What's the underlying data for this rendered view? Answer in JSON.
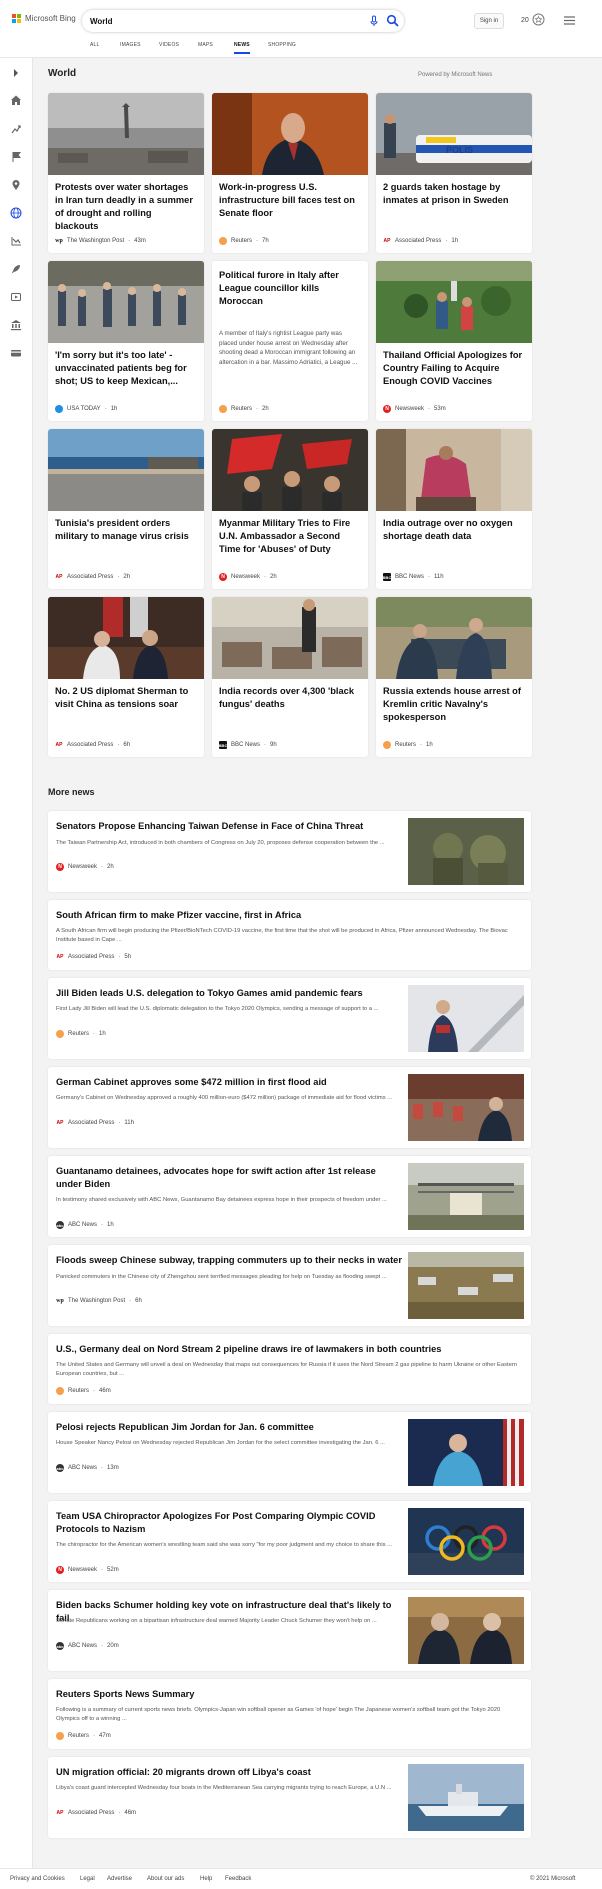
{
  "brand": {
    "name": "Microsoft Bing"
  },
  "search": {
    "query": "World",
    "placeholder": ""
  },
  "header": {
    "sign_in": "Sign in",
    "rewards_points": "20"
  },
  "tabs": [
    {
      "label": "ALL"
    },
    {
      "label": "IMAGES"
    },
    {
      "label": "VIDEOS"
    },
    {
      "label": "MAPS"
    },
    {
      "label": "NEWS",
      "active": true
    },
    {
      "label": "SHOPPING"
    }
  ],
  "section": {
    "title": "World",
    "powered_by": "Powered by Microsoft News"
  },
  "cards": [
    {
      "title": "Protests over water shortages in Iran turn deadly in a summer of drought and rolling blackouts",
      "source": "The Washington Post",
      "age": "43m",
      "logo": "wp"
    },
    {
      "title": "Work-in-progress U.S. infrastructure bill faces test on Senate floor",
      "source": "Reuters",
      "age": "7h",
      "logo": "reuters"
    },
    {
      "title": "2 guards taken hostage by inmates at prison in Sweden",
      "source": "Associated Press",
      "age": "1h",
      "logo": "ap"
    },
    {
      "title": "'I'm sorry but it's too late' - unvaccinated patients beg for shot; US to keep Mexican,...",
      "source": "USA TODAY",
      "age": "1h",
      "logo": "usatoday"
    },
    {
      "title": "Political furore in Italy after League councillor kills Moroccan",
      "description": "A member of Italy's rightist League party was placed under house arrest on Wednesday after shooting dead a Moroccan immigrant following an altercation in a bar. Massimo Adriatici, a League ...",
      "source": "Reuters",
      "age": "2h",
      "logo": "reuters"
    },
    {
      "title": "Thailand Official Apologizes for Country Failing to Acquire Enough COVID Vaccines",
      "source": "Newsweek",
      "age": "53m",
      "logo": "newsweek"
    },
    {
      "title": "Tunisia's president orders military to manage virus crisis",
      "source": "Associated Press",
      "age": "2h",
      "logo": "ap"
    },
    {
      "title": "Myanmar Military Tries to Fire U.N. Ambassador a Second Time for 'Abuses' of Duty",
      "source": "Newsweek",
      "age": "2h",
      "logo": "newsweek"
    },
    {
      "title": "India outrage over no oxygen shortage death data",
      "source": "BBC News",
      "age": "11h",
      "logo": "bbc"
    },
    {
      "title": "No. 2 US diplomat Sherman to visit China as tensions soar",
      "source": "Associated Press",
      "age": "6h",
      "logo": "ap"
    },
    {
      "title": "India records over 4,300 'black fungus' deaths",
      "source": "BBC News",
      "age": "9h",
      "logo": "bbc"
    },
    {
      "title": "Russia extends house arrest of Kremlin critic Navalny's spokesperson",
      "source": "Reuters",
      "age": "1h",
      "logo": "reuters"
    }
  ],
  "more_news": {
    "title": "More news",
    "items": [
      {
        "title": "Senators Propose Enhancing Taiwan Defense in Face of China Threat",
        "description": "The Taiwan Partnership Act, introduced in both chambers of Congress on July 20, proposes defense cooperation between the ...",
        "source": "Newsweek",
        "age": "2h",
        "logo": "newsweek"
      },
      {
        "title": "South African firm to make Pfizer vaccine, first in Africa",
        "description": "A South African firm will begin producing the Pfizer/BioNTech COVID-19 vaccine, the first time that the shot will be produced in Africa, Pfizer announced Wednesday. The Biovac Institute based in Cape ...",
        "source": "Associated Press",
        "age": "5h",
        "logo": "ap"
      },
      {
        "title": "Jill Biden leads U.S. delegation to Tokyo Games amid pandemic fears",
        "description": "First Lady Jill Biden will lead the U.S. diplomatic delegation to the Tokyo 2020 Olympics, sending a message of support to a ...",
        "source": "Reuters",
        "age": "1h",
        "logo": "reuters"
      },
      {
        "title": "German Cabinet approves some $472 million in first flood aid",
        "description": "Germany's Cabinet on Wednesday approved a roughly 400 million-euro ($472 million) package of immediate aid for flood victims ...",
        "source": "Associated Press",
        "age": "11h",
        "logo": "ap"
      },
      {
        "title": "Guantanamo detainees, advocates hope for swift action after 1st release under Biden",
        "description": "In testimony shared exclusively with ABC News, Guantanamo Bay detainees express hope in their prospects of freedom under ...",
        "source": "ABC News",
        "age": "1h",
        "logo": "abc"
      },
      {
        "title": "Floods sweep Chinese subway, trapping commuters up to their necks in water",
        "description": "Panicked commuters in the Chinese city of Zhengzhou sent terrified messages pleading for help on Tuesday as flooding swept ...",
        "source": "The Washington Post",
        "age": "6h",
        "logo": "wp"
      },
      {
        "title": "U.S., Germany deal on Nord Stream 2 pipeline draws ire of lawmakers in both countries",
        "description": "The United States and Germany will unveil a deal on Wednesday that maps out consequences for Russia if it uses the Nord Stream 2 gas pipeline to harm Ukraine or other Eastern European countries, but ...",
        "source": "Reuters",
        "age": "46m",
        "logo": "reuters"
      },
      {
        "title": "Pelosi rejects Republican Jim Jordan for Jan. 6 committee",
        "description": "House Speaker Nancy Pelosi on Wednesday rejected Republican Jim Jordan for the select committee investigating the Jan. 6 ...",
        "source": "ABC News",
        "age": "13m",
        "logo": "abc"
      },
      {
        "title": "Team USA Chiropractor Apologizes For Post Comparing Olympic COVID Protocols to Nazism",
        "description": "The chiropractor for the American women's wrestling team said she was sorry \"for my poor judgment and my choice to share this ...",
        "source": "Newsweek",
        "age": "52m",
        "logo": "newsweek"
      },
      {
        "title": "Biden backs Schumer holding key vote on infrastructure deal that's likely to fail",
        "description": "Senate Republicans working on a bipartisan infrastructure deal warned Majority Leader Chuck Schumer they won't help on ...",
        "source": "ABC News",
        "age": "20m",
        "logo": "abc"
      },
      {
        "title": "Reuters Sports News Summary",
        "description": "Following is a summary of current sports news briefs. Olympics-Japan win softball opener as Games 'of hope' begin The Japanese women's softball team got the Tokyo 2020 Olympics off to a winning ...",
        "source": "Reuters",
        "age": "47m",
        "logo": "reuters"
      },
      {
        "title": "UN migration official: 20 migrants drown off Libya's coast",
        "description": "Libya's coast guard intercepted Wednesday four boats in the Mediterranean Sea carrying migrants trying to reach Europe, a U.N ...",
        "source": "Associated Press",
        "age": "46m",
        "logo": "ap"
      }
    ]
  },
  "footer": {
    "links": [
      "Privacy and Cookies",
      "Legal",
      "Advertise",
      "About our ads",
      "Help",
      "Feedback"
    ],
    "copyright": "© 2021 Microsoft"
  },
  "colors": {
    "accent": "#174ae4",
    "bing_teal": "#008373",
    "page_bg": "#f3f3f3"
  }
}
